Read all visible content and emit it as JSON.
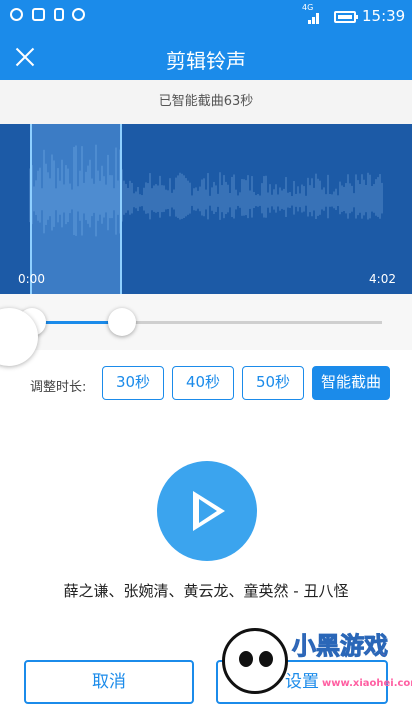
{
  "status_bar": {
    "time": "15:39",
    "network": "4G"
  },
  "header": {
    "title": "剪辑铃声"
  },
  "info": {
    "message": "已智能截曲63秒"
  },
  "waveform": {
    "start_time": "0:00",
    "end_time": "4:02",
    "selection_fraction": 0.26
  },
  "duration": {
    "label": "调整时长:",
    "options": [
      "30秒",
      "40秒",
      "50秒",
      "智能截曲"
    ],
    "selected": "智能截曲"
  },
  "song": {
    "title": "薛之谦、张婉清、黄云龙、童英然 - 丑八怪"
  },
  "actions": {
    "cancel": "取消",
    "set": "设置"
  },
  "watermark": {
    "brand": "小黑游戏",
    "url": "www.xiaohei.com"
  },
  "colors": {
    "accent": "#1b8bea",
    "wave_bg": "#1c5aa6",
    "play": "#3ba4ee"
  }
}
